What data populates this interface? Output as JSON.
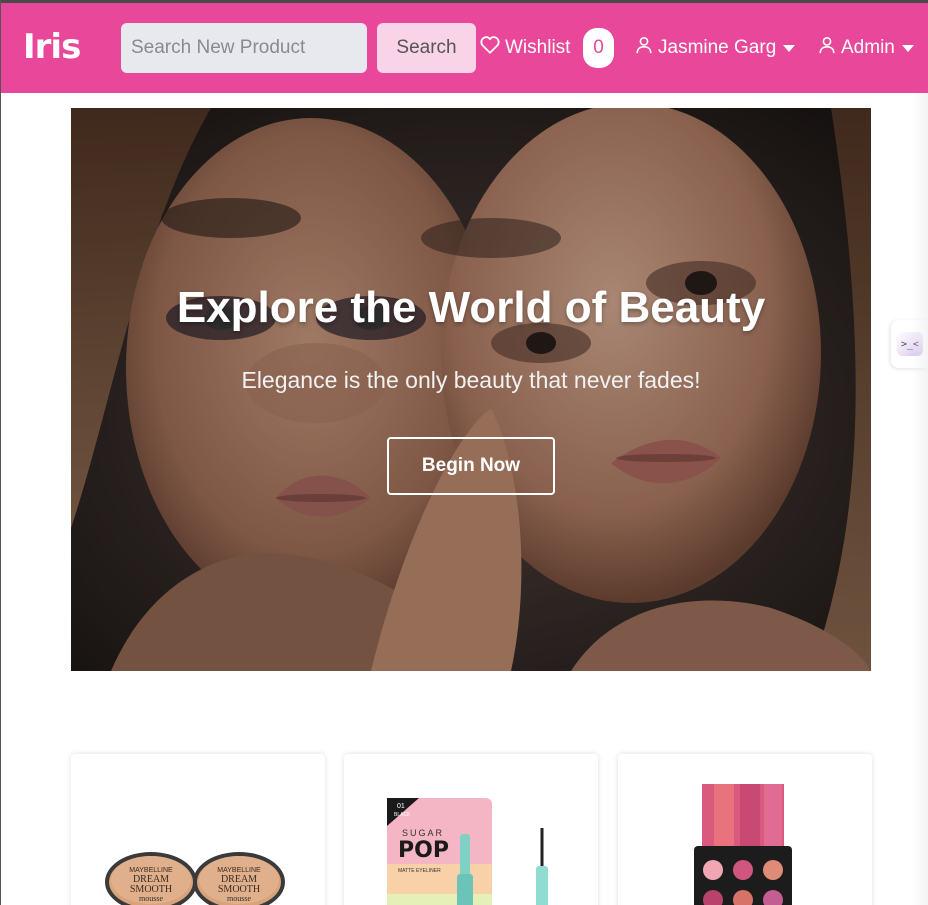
{
  "brand": {
    "name": "Iris"
  },
  "search": {
    "placeholder": "Search New Product",
    "value": "",
    "button_label": "Search"
  },
  "nav": {
    "wishlist_label": "Wishlist",
    "wishlist_count": "0",
    "user_label": "Jasmine Garg",
    "admin_label": "Admin"
  },
  "hero": {
    "title": "Explore the World of Beauty",
    "subtitle": "Elegance is the only beauty that never fades!",
    "button_label": "Begin Now"
  },
  "products": [
    {
      "product_text": [
        "MAYBELLINE",
        "DREAM",
        "SMOOTH",
        "mousse"
      ]
    },
    {
      "product_text": [
        "01",
        "BLACK",
        "SUGAR",
        "POP",
        "MATTE EYELINER"
      ]
    },
    {
      "product_text": []
    }
  ],
  "colors": {
    "navbar": "#e94799",
    "search_button": "#f9d3e8",
    "search_input": "#e8e9ee",
    "badge_text": "#e94799"
  },
  "icons": [
    "heart-icon",
    "user-icon",
    "caret-down-icon",
    "chat-widget-icon"
  ]
}
